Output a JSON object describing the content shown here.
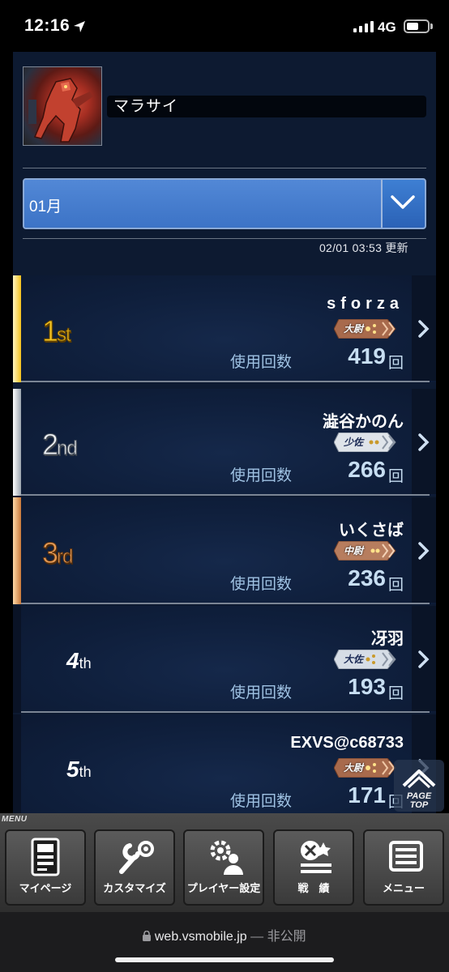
{
  "status_bar": {
    "time": "12:16",
    "network": "4G"
  },
  "profile": {
    "ms_name": "マラサイ"
  },
  "month_select": {
    "value": "01月"
  },
  "updated_text": "02/01 03:53 更新",
  "rankings": [
    {
      "rank": "1",
      "suffix": "st",
      "player": "sforza",
      "grade": "大尉",
      "usage_label": "使用回数",
      "count": "419",
      "unit": "回"
    },
    {
      "rank": "2",
      "suffix": "nd",
      "player": "澁谷かのん",
      "grade": "少佐",
      "usage_label": "使用回数",
      "count": "266",
      "unit": "回"
    },
    {
      "rank": "3",
      "suffix": "rd",
      "player": "いくさば",
      "grade": "中尉",
      "usage_label": "使用回数",
      "count": "236",
      "unit": "回"
    },
    {
      "rank": "4",
      "suffix": "th",
      "player": "冴羽",
      "grade": "大佐",
      "usage_label": "使用回数",
      "count": "193",
      "unit": "回"
    },
    {
      "rank": "5",
      "suffix": "th",
      "player": "EXVS@c68733",
      "grade": "大尉",
      "usage_label": "使用回数",
      "count": "171",
      "unit": "回"
    }
  ],
  "page_top": {
    "label_1": "PAGE",
    "label_2": "TOP"
  },
  "menu": {
    "tag": "MENU",
    "items": [
      {
        "label": "マイページ",
        "icon": "mypage-icon"
      },
      {
        "label": "カスタマイズ",
        "icon": "customize-icon"
      },
      {
        "label": "プレイヤー設定",
        "icon": "player-settings-icon"
      },
      {
        "label": "戦　績",
        "icon": "record-icon"
      },
      {
        "label": "メニュー",
        "icon": "menu-icon"
      }
    ]
  },
  "browser": {
    "domain": "web.vsmobile.jp",
    "privacy": "— 非公開"
  },
  "colors": {
    "gold": "#f7c623",
    "silver": "#eef1f4",
    "bronze": "#e69b56",
    "select_blue": "#3c73c6",
    "background": "#0d1a31"
  }
}
